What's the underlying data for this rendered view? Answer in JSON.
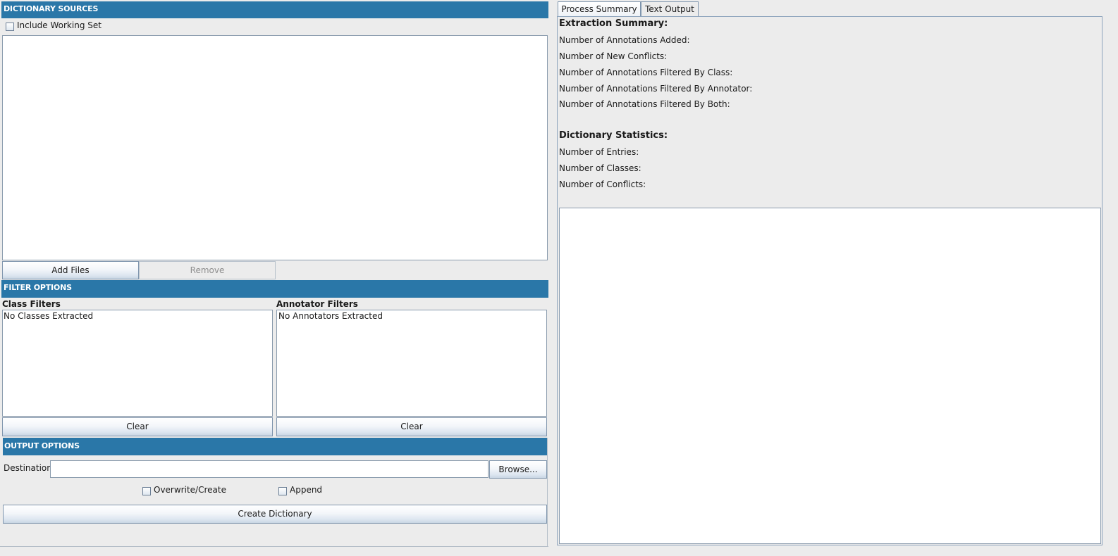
{
  "dictionary_sources": {
    "header": "DICTIONARY SOURCES",
    "include_working_set_label": "Include Working Set",
    "add_files_label": "Add Files",
    "remove_label": "Remove"
  },
  "filter_options": {
    "header": "FILTER OPTIONS",
    "class_filters_title": "Class Filters",
    "class_filters_empty": "No Classes Extracted",
    "annotator_filters_title": "Annotator Filters",
    "annotator_filters_empty": "No Annotators Extracted",
    "clear_label": "Clear"
  },
  "output_options": {
    "header": "OUTPUT OPTIONS",
    "destination_label": "Destination:",
    "destination_value": "",
    "browse_label": "Browse...",
    "overwrite_label": "Overwrite/Create",
    "append_label": "Append",
    "create_label": "Create Dictionary"
  },
  "tabs": [
    {
      "label": "Process Summary",
      "active": true
    },
    {
      "label": "Text Output",
      "active": false
    }
  ],
  "summary": {
    "extraction_title": "Extraction Summary:",
    "annotations_added": "Number of Annotations Added:",
    "new_conflicts": "Number of New Conflicts:",
    "filtered_by_class": "Number of Annotations Filtered By Class:",
    "filtered_by_annotator": "Number of Annotations Filtered By Annotator:",
    "filtered_by_both": "Number of Annotations Filtered By Both:",
    "dictionary_title": "Dictionary Statistics:",
    "entries": "Number of Entries:",
    "classes": "Number of Classes:",
    "conflicts": "Number of Conflicts:"
  },
  "colors": {
    "header_blue": "#2a77a8",
    "panel_bg": "#ececec"
  }
}
